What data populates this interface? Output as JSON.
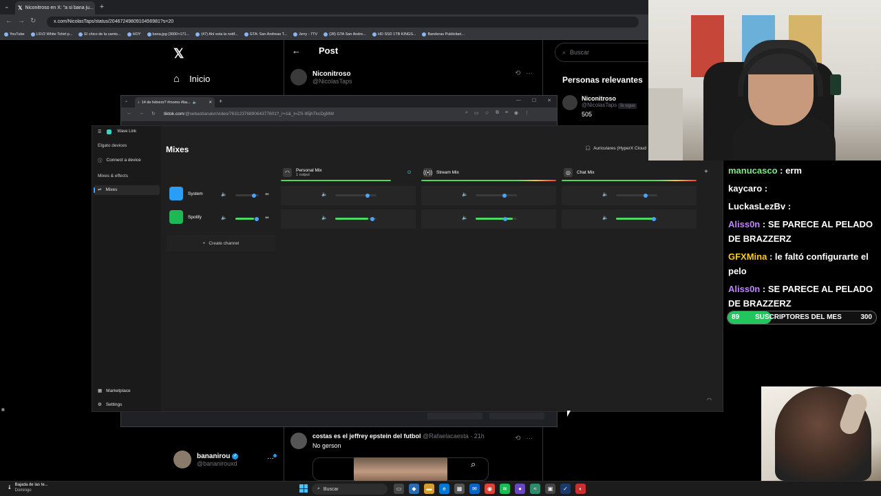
{
  "browser": {
    "tab_title": "Niconitroso en X: \"a si bana ju...",
    "url": "x.com/NicolasTaps/status/2046724980910456981?s=20",
    "bookmarks": [
      "YouTube",
      "LSV2 White Tshirt p...",
      "El chico de la camis...",
      "HOY",
      "bana.jpg (3000×171...",
      "(47) Ahí esta la notif...",
      "GTA: San Andreas T...",
      "Jerry - 7TV",
      "(28) GTA San Andre...",
      "HD SSD 1TB KINGS...",
      "Banderas Publicitari..."
    ]
  },
  "x": {
    "nav_home": "Inicio",
    "post_header": "Post",
    "author_name": "Niconitroso",
    "author_handle": "@NicolasTaps",
    "search_placeholder": "Buscar",
    "relevant_title": "Personas relevantes",
    "relevant_name": "Niconitroso",
    "relevant_handle": "@NicolasTaps",
    "relevant_follows": "Te sigue",
    "relevant_count": "505",
    "reply_name": "costas es el jeffrey epstein del futbol",
    "reply_handle": "@Rafaelacaesta · 21h",
    "reply_text": "No gerson",
    "profile_name": "bananirou",
    "profile_handle": "@bananirouxd"
  },
  "tiktok": {
    "tab_title": "14 de febrero? #momo #ba...",
    "url_host": "tiktok.com",
    "url_path": "/@sebastianalvr/video/7631237689064377601?_r=1&_t=ZS-95jhTkcDgMW"
  },
  "wavelink": {
    "app_name": "Wave Link",
    "section_devices": "Elgato devices",
    "connect_device": "Connect a device",
    "section_mixes": "Mixes & effects",
    "mixes_item": "Mixes",
    "marketplace": "Marketplace",
    "settings": "Settings",
    "page_title": "Mixes",
    "output_device": "Auriculares (HyperX Cloud",
    "mixes": [
      {
        "name": "Personal Mix",
        "sub": "1 output"
      },
      {
        "name": "Stream Mix",
        "sub": ""
      },
      {
        "name": "Chat Mix",
        "sub": ""
      }
    ],
    "channels": [
      {
        "name": "System",
        "levels": [
          0.78,
          0.7,
          0.72
        ],
        "mix_levels": [
          0,
          0,
          0
        ],
        "color": "#2a9df4"
      },
      {
        "name": "Spotify",
        "levels": [
          0.9,
          0.72,
          0.92
        ],
        "mix_levels": [
          0.8,
          0.9,
          0.95
        ],
        "color": "#1db954"
      }
    ],
    "create_channel": "Create channel"
  },
  "chat": [
    {
      "user": "manucasco",
      "text": ": erm",
      "color": "#7ee787"
    },
    {
      "user": "kaycaro",
      "text": ":",
      "color": "#ffffff"
    },
    {
      "user": "LuckasLezBv",
      "text": ":",
      "color": "#ffffff"
    },
    {
      "user": "Aliss0n",
      "text": ": SE PARECE AL PELADO DE BRAZZERZ",
      "color": "#c084fc"
    },
    {
      "user": "GFXMina",
      "text": ": le faltó configurarte el pelo",
      "color": "#facc15"
    },
    {
      "user": "Aliss0n",
      "text": ": SE PARECE AL PELADO DE BRAZZERZ",
      "color": "#c084fc"
    }
  ],
  "subs": {
    "current": "89",
    "label": "SUSCRIPTORES DEL MES",
    "goal": "300",
    "progress": 0.297
  },
  "taskbar": {
    "weather_line1": "Bajada de las te...",
    "weather_line2": "Domingo",
    "search": "Buscar"
  },
  "colors": {
    "accent": "#1d9bf0",
    "wave_accent": "#4aa3ff",
    "meter_green": "#4cd964"
  }
}
